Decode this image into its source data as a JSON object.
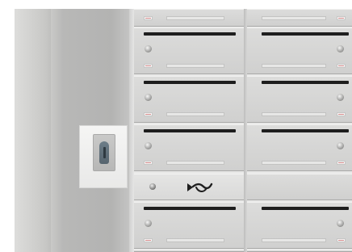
{
  "scene": {
    "description_free": true,
    "wall_color": "#b8b8b7",
    "frame_color": "#e9e9e8",
    "box_color": "#d4d4d3",
    "slot_color": "#1e1e1e",
    "tag_accent": "#d68a8a",
    "icons": [
      "key-switch-icon",
      "posthorn-icon",
      "lock-knob-icon"
    ]
  },
  "mailboxes": {
    "left_column_rows": 5,
    "right_column_rows": 5
  }
}
